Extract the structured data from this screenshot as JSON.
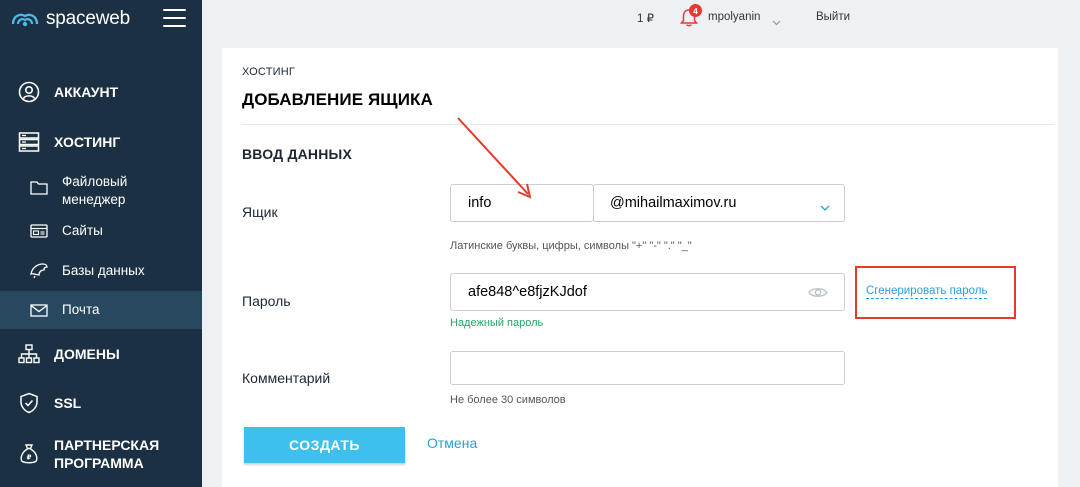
{
  "brand": {
    "logo_text": "spaceweb"
  },
  "sidebar": {
    "items": [
      {
        "label": "АККАУНТ",
        "icon": "user-icon"
      },
      {
        "label": "ХОСТИНГ",
        "icon": "server-icon"
      },
      {
        "label": "ДОМЕНЫ",
        "icon": "sitemap-icon"
      },
      {
        "label": "SSL",
        "icon": "shield-icon"
      },
      {
        "label": "ПАРТНЕРСКАЯ ПРОГРАММА",
        "icon": "money-bag-icon"
      }
    ],
    "sub_items": [
      {
        "label": "Файловый менеджер",
        "icon": "folder-icon"
      },
      {
        "label": "Сайты",
        "icon": "site-icon"
      },
      {
        "label": "Базы данных",
        "icon": "database-icon"
      },
      {
        "label": "Почта",
        "icon": "mail-icon",
        "active": true
      }
    ]
  },
  "topbar": {
    "balance": "1 ₽",
    "notifications_count": "4",
    "username": "mpolyanin",
    "logout_label": "Выйти"
  },
  "page": {
    "breadcrumb": "ХОСТИНГ",
    "title": "ДОБАВЛЕНИЕ ЯЩИКА",
    "section_title": "ВВОД ДАННЫХ"
  },
  "form": {
    "mailbox_label": "Ящик",
    "mailbox_value": "info",
    "domain_value": "@mihailmaximov.ru",
    "mailbox_hint": "Латинские буквы, цифры, символы \"+\" \"-\" \".\" \"_\"",
    "password_label": "Пароль",
    "password_value": "afe848^e8fjzKJdof",
    "password_strength": "Надежный пароль",
    "generate_label": "Сгенерировать пароль",
    "comment_label": "Комментарий",
    "comment_value": "",
    "comment_hint": "Не более 30 символов",
    "submit_label": "СОЗДАТЬ",
    "cancel_label": "Отмена"
  },
  "colors": {
    "sidebar_bg": "#1b3042",
    "sidebar_active": "#27485f",
    "accent": "#3ec0ee",
    "link": "#2a9fd8",
    "success": "#2ba36a",
    "annotation_red": "#e53b2a",
    "badge_red": "#e53935"
  }
}
